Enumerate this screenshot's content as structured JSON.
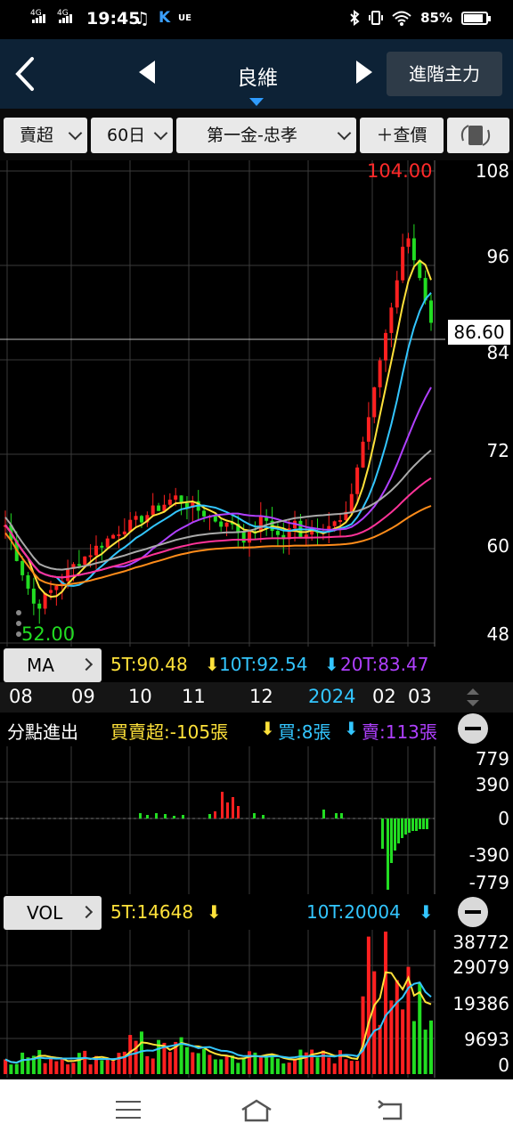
{
  "status_bar": {
    "net1": "4G",
    "net2": "4G",
    "time": "19:45",
    "music": "♫",
    "k_icon": "K",
    "ue": "UE",
    "battery": "85%"
  },
  "header": {
    "title": "良維",
    "advanced_button": "進階主力"
  },
  "toolbar": {
    "type_select": "賣超",
    "period_select": "60日",
    "broker_select": "第一金-忠孝",
    "price_button": "＋查價"
  },
  "price_chart": {
    "high_label": "104.00",
    "low_label": "52.00",
    "current_price": "86.60",
    "y_ticks": [
      "108",
      "96",
      "84",
      "72",
      "60",
      "48"
    ]
  },
  "ma_bar": {
    "button": "MA",
    "ma5": "5T:90.48",
    "ma10": "10T:92.54",
    "ma20": "20T:83.47"
  },
  "time_axis": [
    "08",
    "09",
    "10",
    "11",
    "12",
    "2024",
    "02",
    "03"
  ],
  "broker_panel": {
    "title": "分點進出",
    "net": "買賣超:-105張",
    "buy": "買:8張",
    "sell": "賣:113張",
    "y_ticks": [
      "779",
      "390",
      "0",
      "-390",
      "-779"
    ]
  },
  "vol_bar": {
    "button": "VOL",
    "ma5": "5T:14648",
    "ma10": "10T:20004",
    "y_ticks": [
      "38772",
      "29079",
      "19386",
      "9693",
      "0"
    ]
  },
  "colors": {
    "up": "#ff2020",
    "down": "#22dd22",
    "ma5": "#ffe23a",
    "ma10": "#33c6ff",
    "ma20": "#b040ff",
    "title_bg": "#0d2236"
  },
  "icons": {
    "back": "chevron-left-icon",
    "prev": "triangle-left-icon",
    "next": "triangle-right-icon",
    "rotate": "rotate-screen-icon"
  }
}
